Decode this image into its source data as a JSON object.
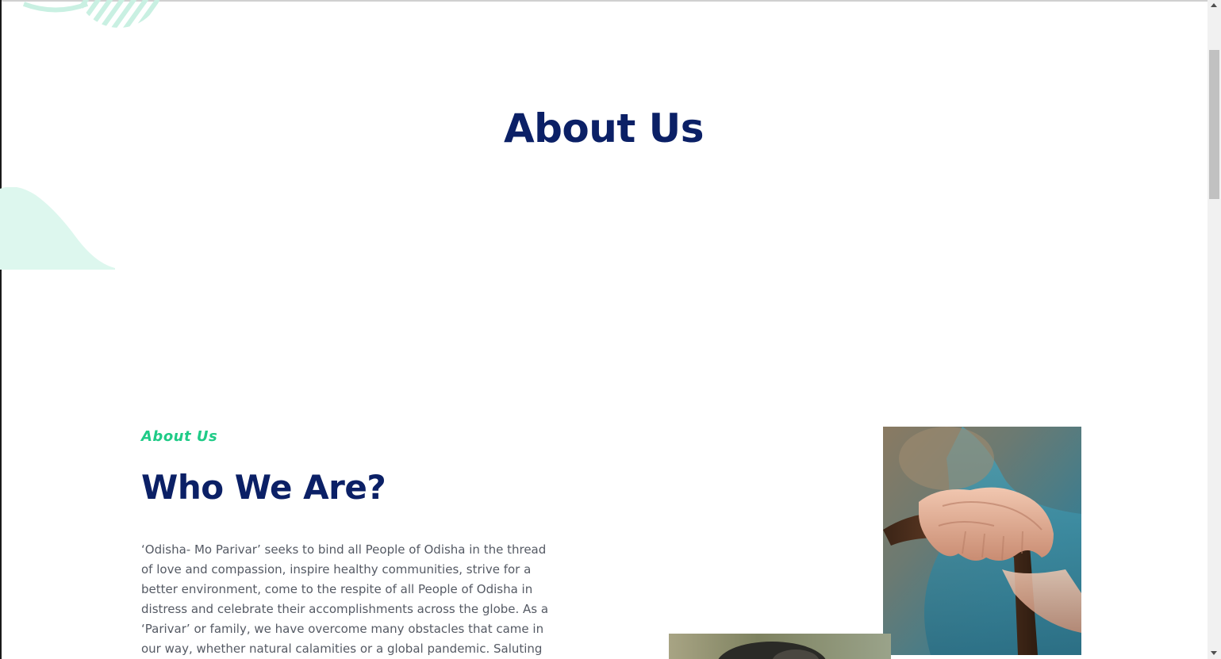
{
  "hero": {
    "title": "About Us"
  },
  "about": {
    "eyebrow": "About Us",
    "title": "Who We Are?",
    "paragraph": "‘Odisha- Mo Parivar’ seeks to bind all People of Odisha in the thread of love and compassion, inspire healthy communities, strive for a better environment, come to the respite of all People of Odisha in distress and celebrate their accomplishments across the globe. As a ‘Parivar’ or family, we have overcome many obstacles that came in our way, whether natural calamities or a global pandemic. Saluting the"
  },
  "images": {
    "hands": "elderly-hands-on-walking-cane-photo",
    "second": "secondary-photo"
  },
  "colors": {
    "navy": "#0b2066",
    "accent_green": "#1fcb87",
    "mint_decoration": "#ddf7ee",
    "body_text": "#555a64"
  }
}
